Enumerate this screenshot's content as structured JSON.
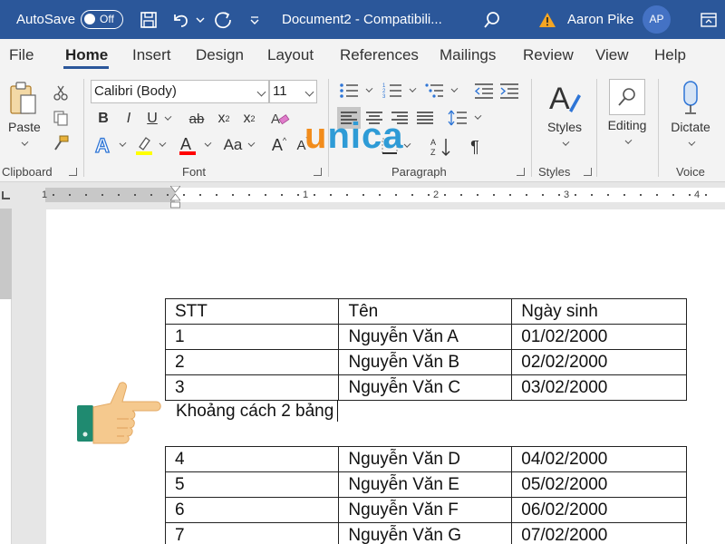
{
  "titlebar": {
    "autosave_label": "AutoSave",
    "autosave_state": "Off",
    "document_title": "Document2  -  Compatibili...",
    "user_name": "Aaron Pike",
    "user_initials": "AP",
    "accent_color": "#2b579a"
  },
  "menu": {
    "tabs": [
      "File",
      "Home",
      "Insert",
      "Design",
      "Layout",
      "References",
      "Mailings",
      "Review",
      "View",
      "Help"
    ],
    "active": "Home"
  },
  "ribbon": {
    "clipboard": {
      "paste_label": "Paste",
      "group_label": "Clipboard"
    },
    "font": {
      "font_name": "Calibri (Body)",
      "font_size": "11",
      "group_label": "Font",
      "buttons": [
        "B",
        "I",
        "U",
        "ab",
        "x",
        "x"
      ],
      "case_label": "Aa",
      "grow_label": "A",
      "shrink_label": "A",
      "highlight_color": "#ffff00",
      "font_color": "#ff0000"
    },
    "paragraph": {
      "group_label": "Paragraph",
      "pilcrow": "¶"
    },
    "styles": {
      "label": "Styles",
      "group_label": "Styles"
    },
    "editing": {
      "label": "Editing"
    },
    "voice": {
      "label": "Dictate",
      "group_label": "Voice"
    }
  },
  "ruler": {
    "marks": [
      "1",
      "1",
      "2",
      "3",
      "4"
    ]
  },
  "watermark": {
    "text": "unica"
  },
  "document": {
    "table1": {
      "header": [
        "STT",
        "Tên",
        "Ngày sinh"
      ],
      "rows": [
        [
          "1",
          "Nguyễn Văn A",
          "01/02/2000"
        ],
        [
          "2",
          "Nguyễn Văn B",
          "02/02/2000"
        ],
        [
          "3",
          "Nguyễn Văn C",
          "03/02/2000"
        ]
      ]
    },
    "gap_text": "Khoảng cách 2 bảng",
    "table2": {
      "rows": [
        [
          "4",
          "Nguyễn Văn D",
          "04/02/2000"
        ],
        [
          "5",
          "Nguyễn Văn E",
          "05/02/2000"
        ],
        [
          "6",
          "Nguyễn Văn F",
          "06/02/2000"
        ],
        [
          "7",
          "Nguyễn Văn G",
          "07/02/2000"
        ]
      ]
    }
  }
}
